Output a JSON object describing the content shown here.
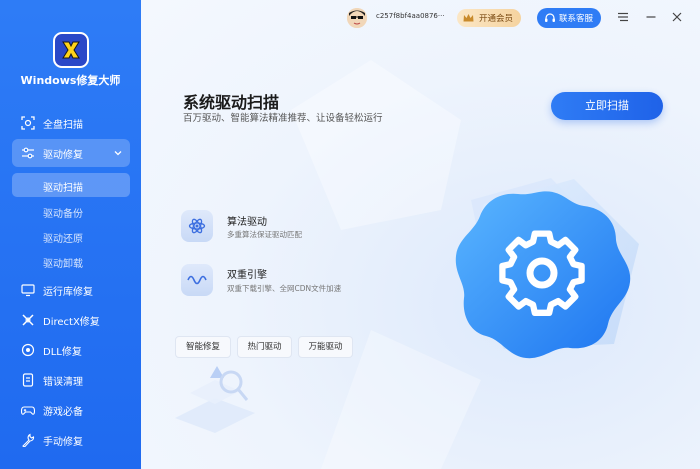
{
  "app": {
    "name": "Windows修复大师"
  },
  "sidebar": {
    "items": [
      {
        "label": "全盘扫描",
        "icon": "scan-icon"
      },
      {
        "label": "驱动修复",
        "icon": "sliders-icon",
        "expanded": true
      },
      {
        "label": "运行库修复",
        "icon": "monitor-icon"
      },
      {
        "label": "DirectX修复",
        "icon": "directx-icon"
      },
      {
        "label": "DLL修复",
        "icon": "dll-icon"
      },
      {
        "label": "错误清理",
        "icon": "clean-icon"
      },
      {
        "label": "游戏必备",
        "icon": "gamepad-icon"
      },
      {
        "label": "手动修复",
        "icon": "wrench-icon"
      }
    ],
    "sub_items": [
      {
        "label": "驱动扫描",
        "active": true
      },
      {
        "label": "驱动备份",
        "active": false
      },
      {
        "label": "驱动还原",
        "active": false
      },
      {
        "label": "驱动卸载",
        "active": false
      }
    ]
  },
  "topbar": {
    "user_id": "c257f8bf4aa0876···",
    "vip_label": "开通会员",
    "service_label": "联系客服"
  },
  "main": {
    "title": "系统驱动扫描",
    "subtitle": "百万驱动、智能算法精准推荐、让设备轻松运行",
    "scan_button": "立即扫描",
    "features": [
      {
        "title": "算法驱动",
        "desc": "多重算法保证驱动匹配",
        "icon": "atom-icon"
      },
      {
        "title": "双重引擎",
        "desc": "双重下载引擎、全网CDN文件加速",
        "icon": "wave-icon"
      }
    ],
    "chips": [
      "智能修复",
      "热门驱动",
      "万能驱动"
    ]
  },
  "colors": {
    "accent": "#2f7cf5",
    "sidebar": "#1f6af0",
    "vip_gold": "#f5d39f"
  }
}
